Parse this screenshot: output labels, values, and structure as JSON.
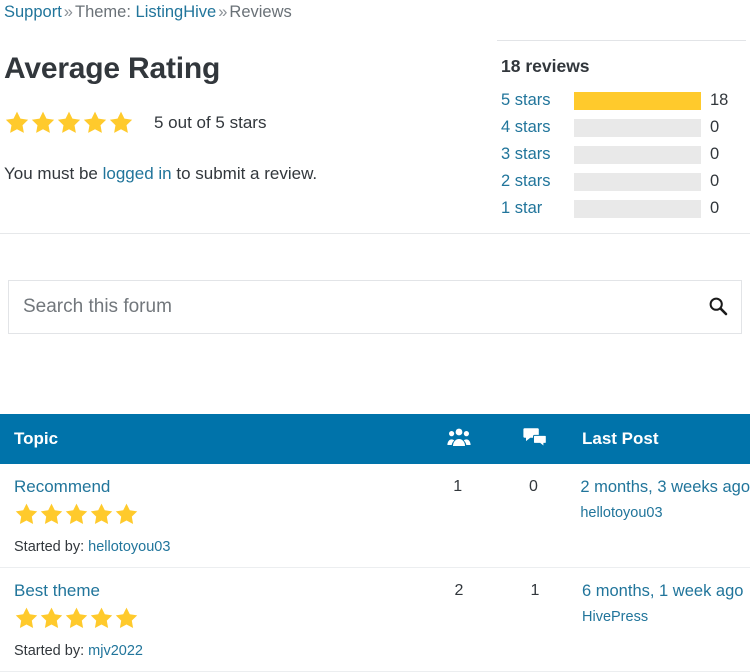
{
  "breadcrumb": {
    "root": "Support",
    "separator": "»",
    "theme_prefix": "Theme:",
    "theme_name": "ListingHive",
    "current": "Reviews"
  },
  "average_rating": {
    "heading": "Average Rating",
    "stars_filled": 5,
    "stars_total": 5,
    "summary": "5 out of 5 stars",
    "notice_before": "You must be ",
    "notice_link": "logged in",
    "notice_after": " to submit a review."
  },
  "breakdown": {
    "reviews_count_label": "18 reviews",
    "rows": [
      {
        "label": "5 stars",
        "count": "18",
        "percent": 100
      },
      {
        "label": "4 stars",
        "count": "0",
        "percent": 0
      },
      {
        "label": "3 stars",
        "count": "0",
        "percent": 0
      },
      {
        "label": "2 stars",
        "count": "0",
        "percent": 0
      },
      {
        "label": "1 star",
        "count": "0",
        "percent": 0
      }
    ]
  },
  "search": {
    "placeholder": "Search this forum",
    "value": "",
    "icon": "search-icon"
  },
  "table": {
    "headers": {
      "topic": "Topic",
      "voices_icon": "users-group-icon",
      "replies_icon": "speech-bubbles-icon",
      "last_post": "Last Post"
    },
    "rows": [
      {
        "title": "Recommend",
        "stars": 5,
        "started_by_label": "Started by:",
        "started_by_author": "hellotoyou03",
        "voices": "1",
        "replies": "0",
        "last_post_time": "2 months, 3 weeks ago",
        "last_post_author": "hellotoyou03"
      },
      {
        "title": "Best theme",
        "stars": 5,
        "started_by_label": "Started by:",
        "started_by_author": "mjv2022",
        "voices": "2",
        "replies": "1",
        "last_post_time": "6 months, 1 week ago",
        "last_post_author": "HivePress"
      }
    ]
  },
  "colors": {
    "link": "#21759b",
    "header_bar": "#0073aa",
    "star": "#ffca2c",
    "bar_track": "#e9e9e9",
    "text": "#32373c"
  }
}
